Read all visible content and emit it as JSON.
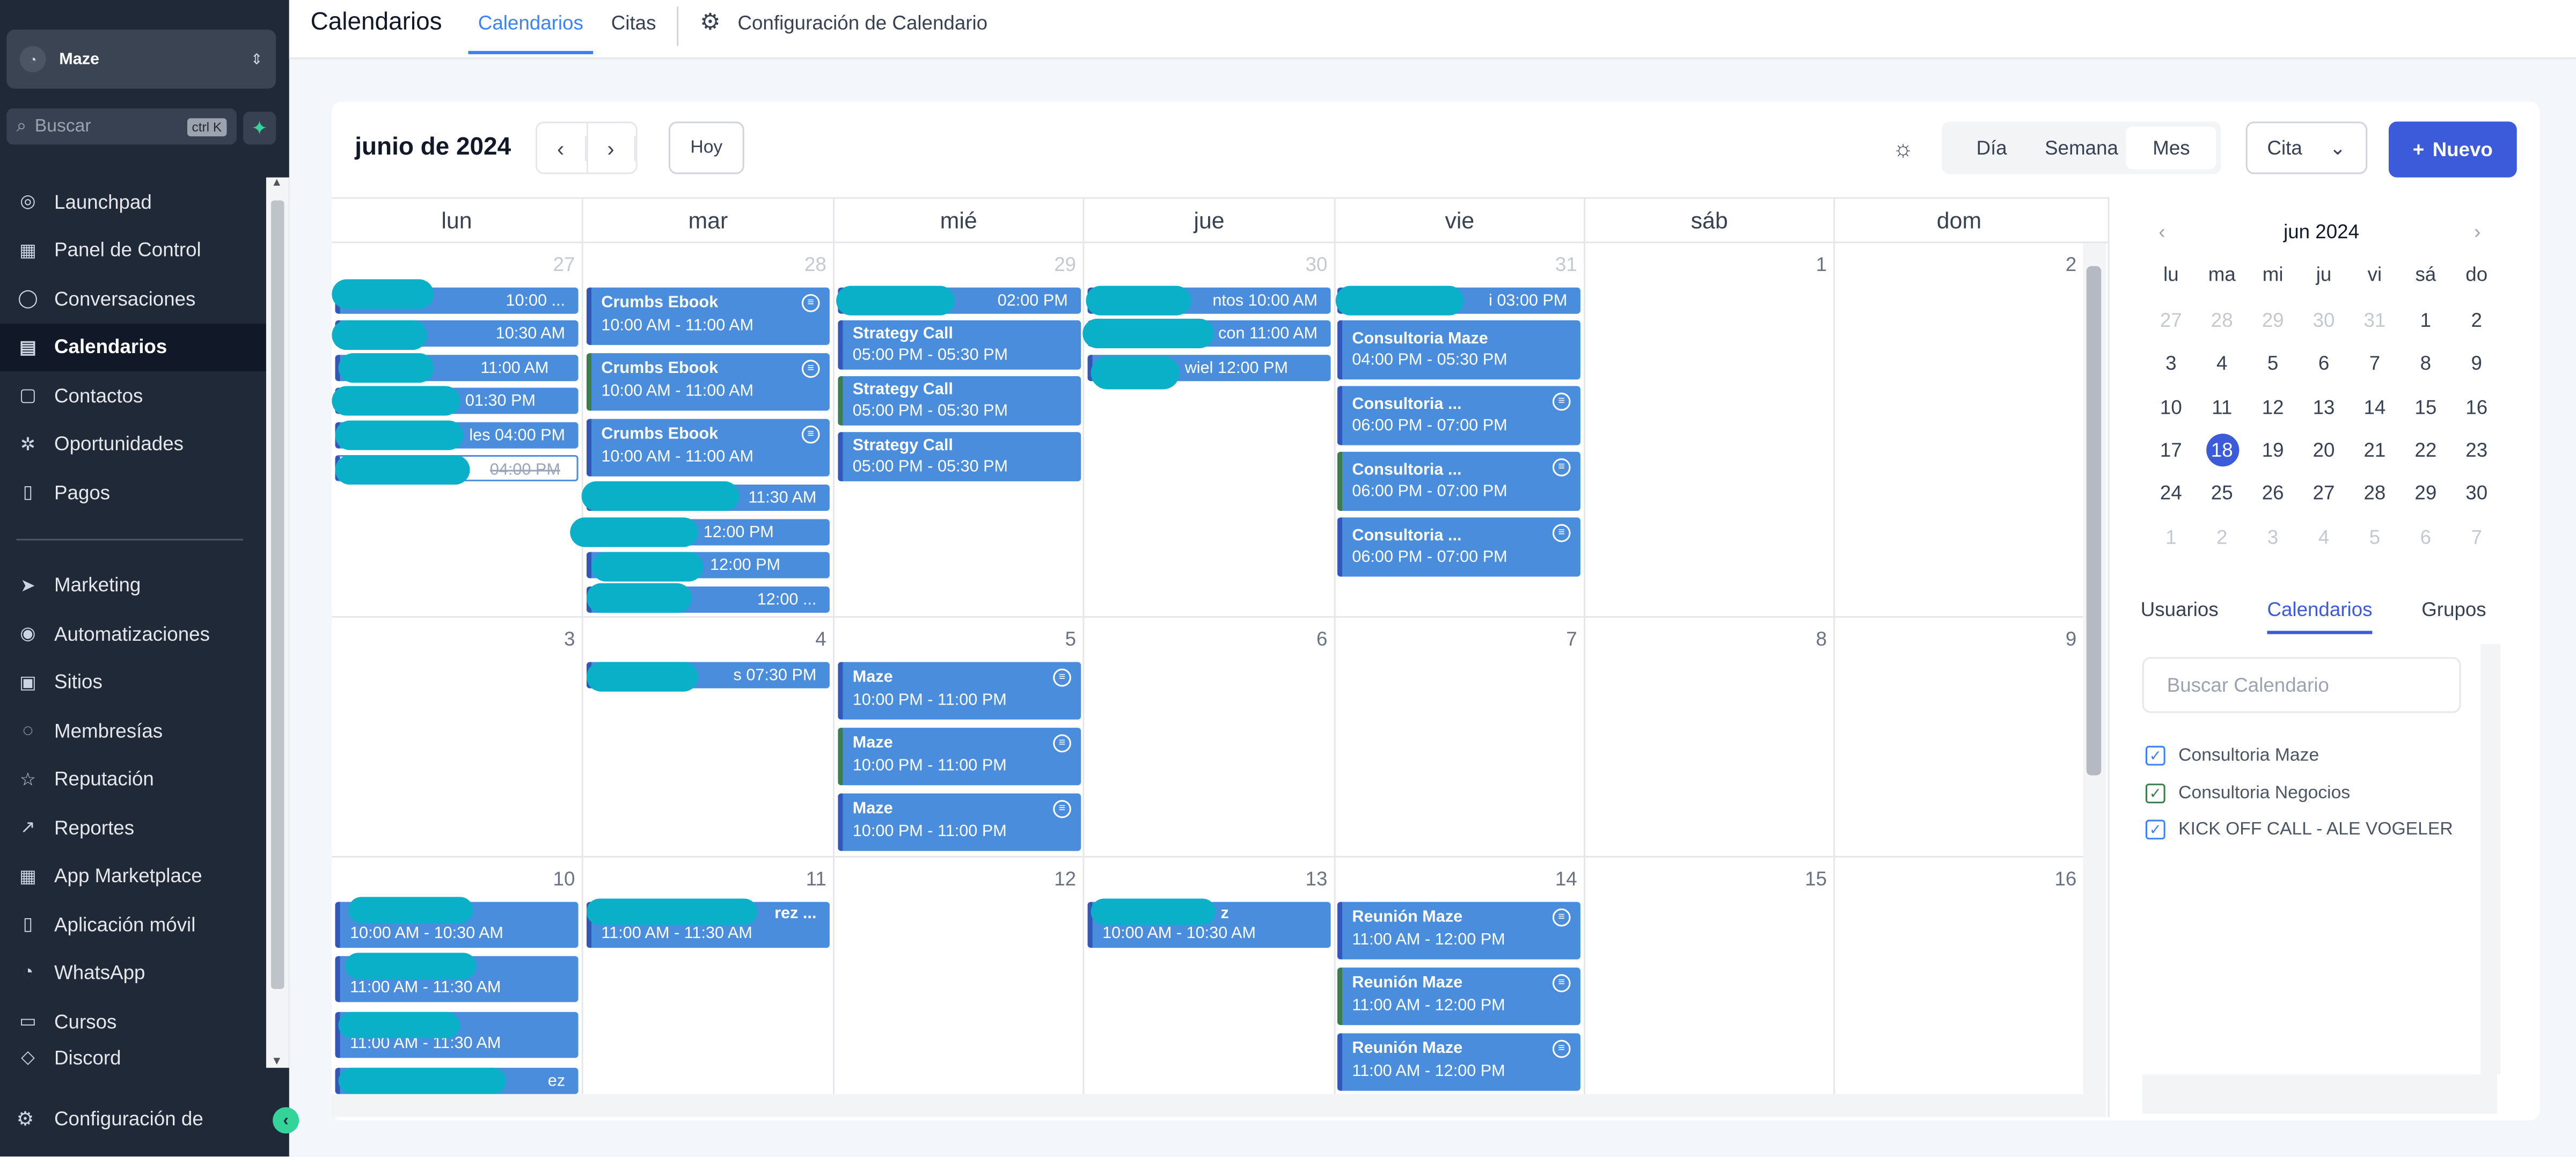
{
  "sidebar": {
    "account": "Maze",
    "search_placeholder": "Buscar",
    "search_kbd": "ctrl K",
    "items": [
      {
        "label": "Launchpad",
        "icon": "rocket-icon"
      },
      {
        "label": "Panel de Control",
        "icon": "dashboard-icon"
      },
      {
        "label": "Conversaciones",
        "icon": "chat-icon"
      },
      {
        "label": "Calendarios",
        "icon": "calendar-icon",
        "active": true
      },
      {
        "label": "Contactos",
        "icon": "contacts-icon"
      },
      {
        "label": "Oportunidades",
        "icon": "funnel-icon"
      },
      {
        "label": "Pagos",
        "icon": "receipt-icon"
      },
      {
        "label": "Marketing",
        "icon": "send-icon"
      },
      {
        "label": "Automatizaciones",
        "icon": "automation-icon"
      },
      {
        "label": "Sitios",
        "icon": "globe-icon"
      },
      {
        "label": "Membresías",
        "icon": "membership-icon"
      },
      {
        "label": "Reputación",
        "icon": "star-icon"
      },
      {
        "label": "Reportes",
        "icon": "chart-icon"
      },
      {
        "label": "App Marketplace",
        "icon": "grid-icon"
      },
      {
        "label": "Aplicación móvil",
        "icon": "phone-icon"
      },
      {
        "label": "WhatsApp",
        "icon": "whatsapp-icon"
      },
      {
        "label": "Cursos",
        "icon": "courses-icon"
      },
      {
        "label": "Discord",
        "icon": "discord-icon"
      }
    ],
    "settings": "Configuración de"
  },
  "topbar": {
    "title": "Calendarios",
    "tabs": [
      "Calendarios",
      "Citas",
      "Configuración de Calendario"
    ]
  },
  "calendar": {
    "month_label": "junio de 2024",
    "today_btn": "Hoy",
    "views": [
      "Día",
      "Semana",
      "Mes"
    ],
    "active_view": "Mes",
    "type_select": "Cita",
    "new_btn": "Nuevo",
    "weekdays": [
      "lun",
      "mar",
      "mié",
      "jue",
      "vie",
      "sáb",
      "dom"
    ],
    "weeks": [
      [
        "27",
        "28",
        "29",
        "30",
        "31",
        "1",
        "2"
      ],
      [
        "3",
        "4",
        "5",
        "6",
        "7",
        "8",
        "9"
      ],
      [
        "10",
        "11",
        "12",
        "13",
        "14",
        "15",
        "16"
      ]
    ],
    "events": {
      "w0_mon": [
        "10:00 ...",
        "10:30 AM",
        "11:00 AM",
        "01:30 PM",
        "les 04:00 PM",
        "04:00 PM"
      ],
      "w0_tue": [
        {
          "title": "Crumbs Ebook",
          "time": "10:00 AM - 11:00 AM"
        },
        {
          "title": "Crumbs Ebook",
          "time": "10:00 AM - 11:00 AM"
        },
        {
          "title": "Crumbs Ebook",
          "time": "10:00 AM - 11:00 AM"
        }
      ],
      "w0_tue_more": [
        "11:30 AM",
        "12:00 PM",
        "12:00 PM",
        "12:00 ..."
      ],
      "w0_wed_top": "02:00 PM",
      "w0_wed": [
        {
          "title": "Strategy Call",
          "time": "05:00 PM - 05:30 PM"
        },
        {
          "title": "Strategy Call",
          "time": "05:00 PM - 05:30 PM"
        },
        {
          "title": "Strategy Call",
          "time": "05:00 PM - 05:30 PM"
        }
      ],
      "w0_thu": [
        "ntos 10:00 AM",
        "con 11:00 AM",
        "wiel 12:00 PM"
      ],
      "w0_fri_top": "i 03:00 PM",
      "w0_fri": [
        {
          "title": "Consultoria Maze",
          "time": "04:00 PM - 05:30 PM"
        },
        {
          "title": "Consultoria ...",
          "time": "06:00 PM - 07:00 PM"
        },
        {
          "title": "Consultoria ...",
          "time": "06:00 PM - 07:00 PM"
        },
        {
          "title": "Consultoria ...",
          "time": "06:00 PM - 07:00 PM"
        }
      ],
      "w1_tue": "s 07:30 PM",
      "w1_wed": [
        {
          "title": "Maze",
          "time": "10:00 PM - 11:00 PM"
        },
        {
          "title": "Maze",
          "time": "10:00 PM - 11:00 PM"
        },
        {
          "title": "Maze",
          "time": "10:00 PM - 11:00 PM"
        }
      ],
      "w2_mon": [
        "10:00 AM - 10:30 AM",
        "11:00 AM - 11:30 AM",
        "11:00 AM - 11:30 AM",
        "ez"
      ],
      "w2_tue": {
        "title": "rez ...",
        "time": "11:00 AM - 11:30 AM"
      },
      "w2_thu": {
        "title": "z",
        "time": "10:00 AM - 10:30 AM"
      },
      "w2_fri": [
        {
          "title": "Reunión Maze",
          "time": "11:00 AM - 12:00 PM"
        },
        {
          "title": "Reunión Maze",
          "time": "11:00 AM - 12:00 PM"
        },
        {
          "title": "Reunión Maze",
          "time": "11:00 AM - 12:00 PM"
        }
      ]
    }
  },
  "mini": {
    "title": "jun 2024",
    "headers": [
      "lu",
      "ma",
      "mi",
      "ju",
      "vi",
      "sá",
      "do"
    ],
    "rows": [
      [
        "27",
        "28",
        "29",
        "30",
        "31",
        "1",
        "2"
      ],
      [
        "3",
        "4",
        "5",
        "6",
        "7",
        "8",
        "9"
      ],
      [
        "10",
        "11",
        "12",
        "13",
        "14",
        "15",
        "16"
      ],
      [
        "17",
        "18",
        "19",
        "20",
        "21",
        "22",
        "23"
      ],
      [
        "24",
        "25",
        "26",
        "27",
        "28",
        "29",
        "30"
      ],
      [
        "1",
        "2",
        "3",
        "4",
        "5",
        "6",
        "7"
      ]
    ],
    "selected": "18"
  },
  "filters": {
    "tabs": [
      "Usuarios",
      "Calendarios",
      "Grupos"
    ],
    "active": "Calendarios",
    "search_placeholder": "Buscar Calendario",
    "calendars": [
      "Consultoria Maze",
      "Consultoria Negocios",
      "KICK OFF CALL - ALE VOGELER"
    ]
  }
}
